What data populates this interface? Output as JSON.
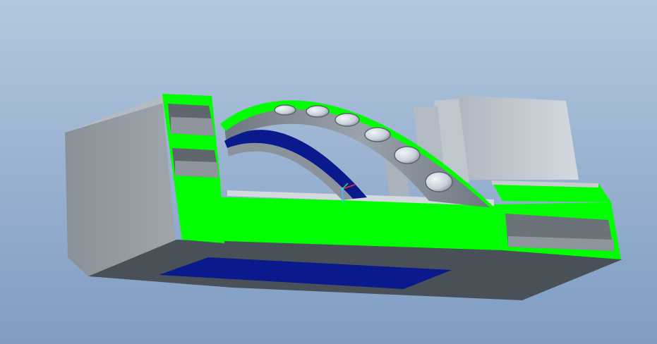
{
  "viewport": {
    "background_top": "#b3c7de",
    "background_bottom": "#7f9cc3"
  },
  "model": {
    "name": "",
    "colors": {
      "highlight": "#00ff00",
      "body_light": "#b9bfc6",
      "body_mid": "#8b9299",
      "body_dark": "#5f666d",
      "cut_surface": "#3b4148",
      "accent_blue": "#0a1a8c",
      "arch_rim": "#7e8591",
      "fin": "#c7ced6"
    },
    "arch_holes": 6
  },
  "coordinate_triad": {
    "x_color": "#ff2a2a",
    "y_color": "#27e15a",
    "z_color": "#35c7ff"
  }
}
